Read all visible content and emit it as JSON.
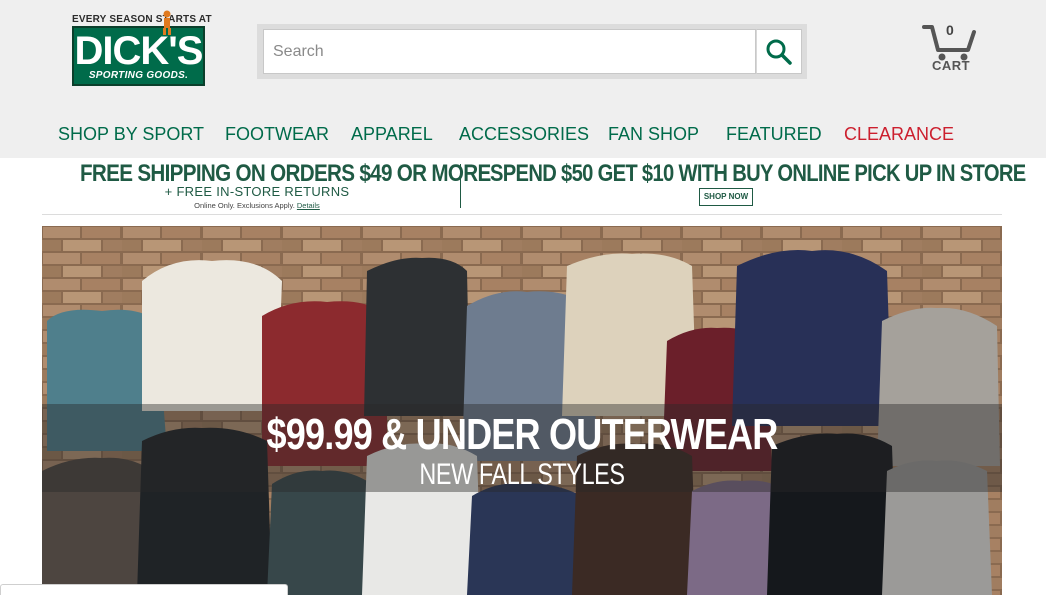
{
  "brand": {
    "tagline": "EVERY SEASON STARTS AT",
    "name": "DICK'S",
    "sub": "SPORTING GOODS."
  },
  "search": {
    "placeholder": "Search",
    "value": ""
  },
  "cart": {
    "count": "0",
    "label": "CART"
  },
  "nav": {
    "items": [
      {
        "label": "SHOP BY SPORT"
      },
      {
        "label": "FOOTWEAR"
      },
      {
        "label": "APPAREL"
      },
      {
        "label": "ACCESSORIES"
      },
      {
        "label": "FAN SHOP"
      },
      {
        "label": "FEATURED"
      },
      {
        "label": "CLEARANCE"
      }
    ]
  },
  "promo": {
    "left_title": "FREE SHIPPING ON ORDERS $49 OR MORE",
    "left_sub": "+ FREE IN-STORE RETURNS",
    "left_fine": "Online Only. Exclusions Apply.",
    "details_link": "Details",
    "right_title": "SPEND $50 GET $10 WITH BUY ONLINE PICK UP IN STORE",
    "shop_now": "SHOP NOW"
  },
  "hero": {
    "title": "$99.99 & UNDER OUTERWEAR",
    "subtitle": "NEW FALL STYLES"
  },
  "colors": {
    "brand_green": "#006b4a",
    "clearance_red": "#cc1f2e",
    "header_bg": "#efefef"
  }
}
